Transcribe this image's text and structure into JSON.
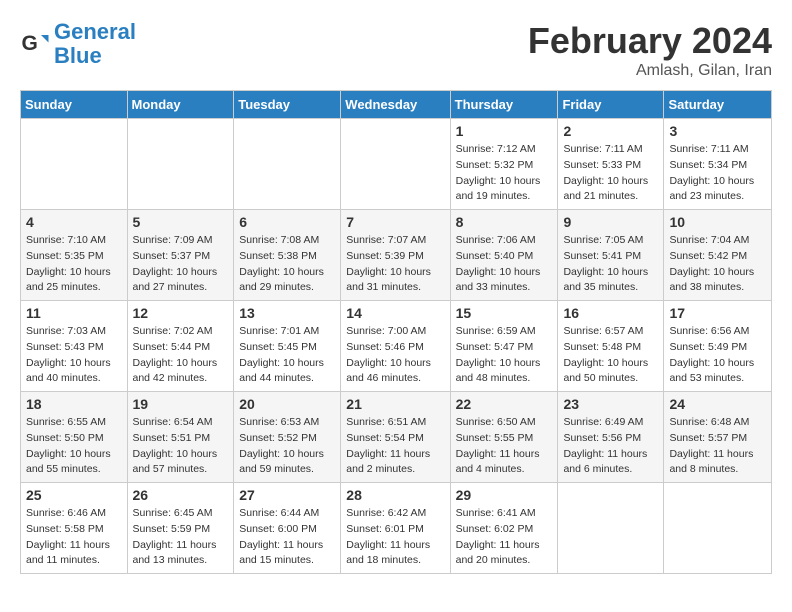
{
  "logo": {
    "line1": "General",
    "line2": "Blue"
  },
  "title": "February 2024",
  "subtitle": "Amlash, Gilan, Iran",
  "days_header": [
    "Sunday",
    "Monday",
    "Tuesday",
    "Wednesday",
    "Thursday",
    "Friday",
    "Saturday"
  ],
  "weeks": [
    [
      {
        "day": "",
        "sunrise": "",
        "sunset": "",
        "daylight": ""
      },
      {
        "day": "",
        "sunrise": "",
        "sunset": "",
        "daylight": ""
      },
      {
        "day": "",
        "sunrise": "",
        "sunset": "",
        "daylight": ""
      },
      {
        "day": "",
        "sunrise": "",
        "sunset": "",
        "daylight": ""
      },
      {
        "day": "1",
        "sunrise": "7:12 AM",
        "sunset": "5:32 PM",
        "daylight": "10 hours and 19 minutes."
      },
      {
        "day": "2",
        "sunrise": "7:11 AM",
        "sunset": "5:33 PM",
        "daylight": "10 hours and 21 minutes."
      },
      {
        "day": "3",
        "sunrise": "7:11 AM",
        "sunset": "5:34 PM",
        "daylight": "10 hours and 23 minutes."
      }
    ],
    [
      {
        "day": "4",
        "sunrise": "7:10 AM",
        "sunset": "5:35 PM",
        "daylight": "10 hours and 25 minutes."
      },
      {
        "day": "5",
        "sunrise": "7:09 AM",
        "sunset": "5:37 PM",
        "daylight": "10 hours and 27 minutes."
      },
      {
        "day": "6",
        "sunrise": "7:08 AM",
        "sunset": "5:38 PM",
        "daylight": "10 hours and 29 minutes."
      },
      {
        "day": "7",
        "sunrise": "7:07 AM",
        "sunset": "5:39 PM",
        "daylight": "10 hours and 31 minutes."
      },
      {
        "day": "8",
        "sunrise": "7:06 AM",
        "sunset": "5:40 PM",
        "daylight": "10 hours and 33 minutes."
      },
      {
        "day": "9",
        "sunrise": "7:05 AM",
        "sunset": "5:41 PM",
        "daylight": "10 hours and 35 minutes."
      },
      {
        "day": "10",
        "sunrise": "7:04 AM",
        "sunset": "5:42 PM",
        "daylight": "10 hours and 38 minutes."
      }
    ],
    [
      {
        "day": "11",
        "sunrise": "7:03 AM",
        "sunset": "5:43 PM",
        "daylight": "10 hours and 40 minutes."
      },
      {
        "day": "12",
        "sunrise": "7:02 AM",
        "sunset": "5:44 PM",
        "daylight": "10 hours and 42 minutes."
      },
      {
        "day": "13",
        "sunrise": "7:01 AM",
        "sunset": "5:45 PM",
        "daylight": "10 hours and 44 minutes."
      },
      {
        "day": "14",
        "sunrise": "7:00 AM",
        "sunset": "5:46 PM",
        "daylight": "10 hours and 46 minutes."
      },
      {
        "day": "15",
        "sunrise": "6:59 AM",
        "sunset": "5:47 PM",
        "daylight": "10 hours and 48 minutes."
      },
      {
        "day": "16",
        "sunrise": "6:57 AM",
        "sunset": "5:48 PM",
        "daylight": "10 hours and 50 minutes."
      },
      {
        "day": "17",
        "sunrise": "6:56 AM",
        "sunset": "5:49 PM",
        "daylight": "10 hours and 53 minutes."
      }
    ],
    [
      {
        "day": "18",
        "sunrise": "6:55 AM",
        "sunset": "5:50 PM",
        "daylight": "10 hours and 55 minutes."
      },
      {
        "day": "19",
        "sunrise": "6:54 AM",
        "sunset": "5:51 PM",
        "daylight": "10 hours and 57 minutes."
      },
      {
        "day": "20",
        "sunrise": "6:53 AM",
        "sunset": "5:52 PM",
        "daylight": "10 hours and 59 minutes."
      },
      {
        "day": "21",
        "sunrise": "6:51 AM",
        "sunset": "5:54 PM",
        "daylight": "11 hours and 2 minutes."
      },
      {
        "day": "22",
        "sunrise": "6:50 AM",
        "sunset": "5:55 PM",
        "daylight": "11 hours and 4 minutes."
      },
      {
        "day": "23",
        "sunrise": "6:49 AM",
        "sunset": "5:56 PM",
        "daylight": "11 hours and 6 minutes."
      },
      {
        "day": "24",
        "sunrise": "6:48 AM",
        "sunset": "5:57 PM",
        "daylight": "11 hours and 8 minutes."
      }
    ],
    [
      {
        "day": "25",
        "sunrise": "6:46 AM",
        "sunset": "5:58 PM",
        "daylight": "11 hours and 11 minutes."
      },
      {
        "day": "26",
        "sunrise": "6:45 AM",
        "sunset": "5:59 PM",
        "daylight": "11 hours and 13 minutes."
      },
      {
        "day": "27",
        "sunrise": "6:44 AM",
        "sunset": "6:00 PM",
        "daylight": "11 hours and 15 minutes."
      },
      {
        "day": "28",
        "sunrise": "6:42 AM",
        "sunset": "6:01 PM",
        "daylight": "11 hours and 18 minutes."
      },
      {
        "day": "29",
        "sunrise": "6:41 AM",
        "sunset": "6:02 PM",
        "daylight": "11 hours and 20 minutes."
      },
      {
        "day": "",
        "sunrise": "",
        "sunset": "",
        "daylight": ""
      },
      {
        "day": "",
        "sunrise": "",
        "sunset": "",
        "daylight": ""
      }
    ]
  ]
}
